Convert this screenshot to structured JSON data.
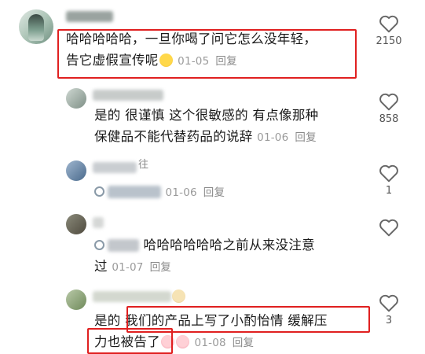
{
  "comments": [
    {
      "text_line1": "哈哈哈哈哈，一旦你喝了问它怎么没年轻，",
      "text_line2": "告它虚假宣传呢",
      "date": "01-05",
      "reply": "回复",
      "likes": "2150"
    },
    {
      "text_line1": "是的 很谨慎 这个很敏感的 有点像那种",
      "text_line2": "保健品不能代替药品的说辞",
      "date": "01-06",
      "reply": "回复",
      "likes": "858"
    },
    {
      "date": "01-06",
      "reply": "回复",
      "likes": "1",
      "name_fragment": "往"
    },
    {
      "text_line1": "哈哈哈哈哈哈之前从来没注意",
      "text_line2": "过",
      "date": "01-07",
      "reply": "回复",
      "likes": ""
    },
    {
      "text_line1a": "是的",
      "text_line1b": "我们的产品上写了小酌怡情 缓解压",
      "text_line2": "力也被告了",
      "date": "01-08",
      "reply": "回复",
      "likes": "3"
    }
  ],
  "colors": {
    "highlight": "#e02020",
    "meta": "#9a9a9a"
  },
  "icons": [
    "heart-outline-icon",
    "mention-icon",
    "emoji-icon"
  ]
}
